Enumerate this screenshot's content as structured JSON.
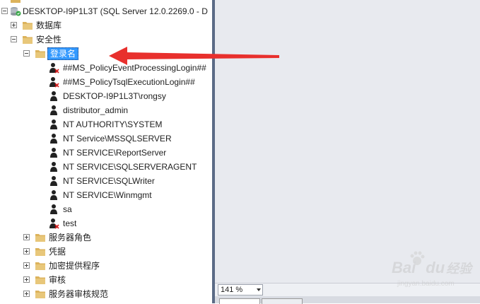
{
  "server": {
    "label": "DESKTOP-I9P1L3T (SQL Server 12.0.2269.0 - D"
  },
  "tree": {
    "databases": "数据库",
    "security": "安全性",
    "logins": "登录名",
    "login_items": [
      {
        "label": "##MS_PolicyEventProcessingLogin##",
        "disabled": true
      },
      {
        "label": "##MS_PolicyTsqlExecutionLogin##",
        "disabled": true
      },
      {
        "label": "DESKTOP-I9P1L3T\\rongsy",
        "disabled": false
      },
      {
        "label": "distributor_admin",
        "disabled": false
      },
      {
        "label": "NT AUTHORITY\\SYSTEM",
        "disabled": false
      },
      {
        "label": "NT Service\\MSSQLSERVER",
        "disabled": false
      },
      {
        "label": "NT SERVICE\\ReportServer",
        "disabled": false
      },
      {
        "label": "NT SERVICE\\SQLSERVERAGENT",
        "disabled": false
      },
      {
        "label": "NT SERVICE\\SQLWriter",
        "disabled": false
      },
      {
        "label": "NT SERVICE\\Winmgmt",
        "disabled": false
      },
      {
        "label": "sa",
        "disabled": false
      },
      {
        "label": "test",
        "disabled": true
      }
    ],
    "security_children": [
      "服务器角色",
      "凭据",
      "加密提供程序",
      "审核",
      "服务器审核规范"
    ]
  },
  "zoom": {
    "value": "141 %"
  },
  "watermark": {
    "brand": "Bai",
    "brand_accent": "du",
    "suffix": "经验",
    "url": "jingyan.baidu.com"
  },
  "colors": {
    "arrow": "#e8302d",
    "folder": "#dcb35c",
    "selection": "#3399ff",
    "splitter": "#5b6b86"
  }
}
